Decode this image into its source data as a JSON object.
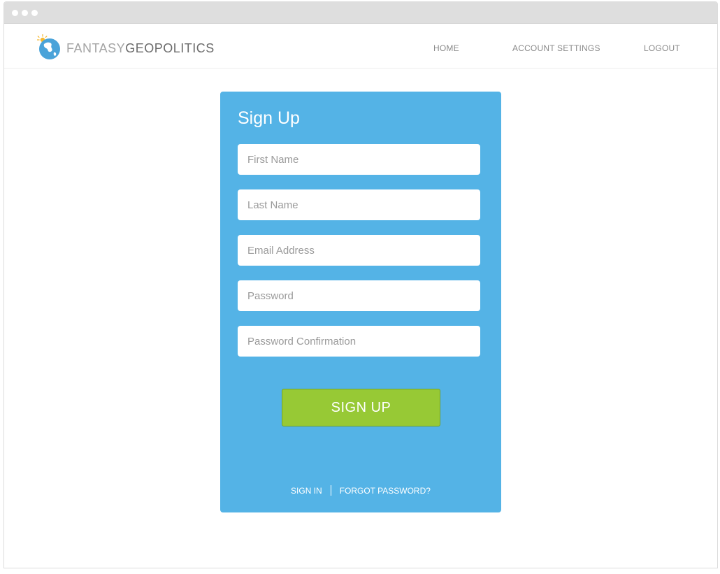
{
  "brand": {
    "name_light": "FANTASY",
    "name_dark": "GEOPOLITICS",
    "icon": "globe-sun-icon",
    "colors": {
      "globe": "#4aa3d9",
      "sun": "#f5b82e"
    }
  },
  "nav": {
    "home": "HOME",
    "account_settings": "ACCOUNT SETTINGS",
    "logout": "LOGOUT"
  },
  "form": {
    "title": "Sign Up",
    "fields": {
      "first_name": {
        "placeholder": "First Name",
        "value": ""
      },
      "last_name": {
        "placeholder": "Last Name",
        "value": ""
      },
      "email": {
        "placeholder": "Email Address",
        "value": ""
      },
      "password": {
        "placeholder": "Password",
        "value": ""
      },
      "password_confirmation": {
        "placeholder": "Password Confirmation",
        "value": ""
      }
    },
    "submit_label": "SIGN UP",
    "links": {
      "sign_in": "SIGN IN",
      "forgot_password": "FORGOT PASSWORD?"
    }
  },
  "colors": {
    "card": "#54b3e6",
    "button": "#97c935",
    "titlebar": "#dedede"
  }
}
